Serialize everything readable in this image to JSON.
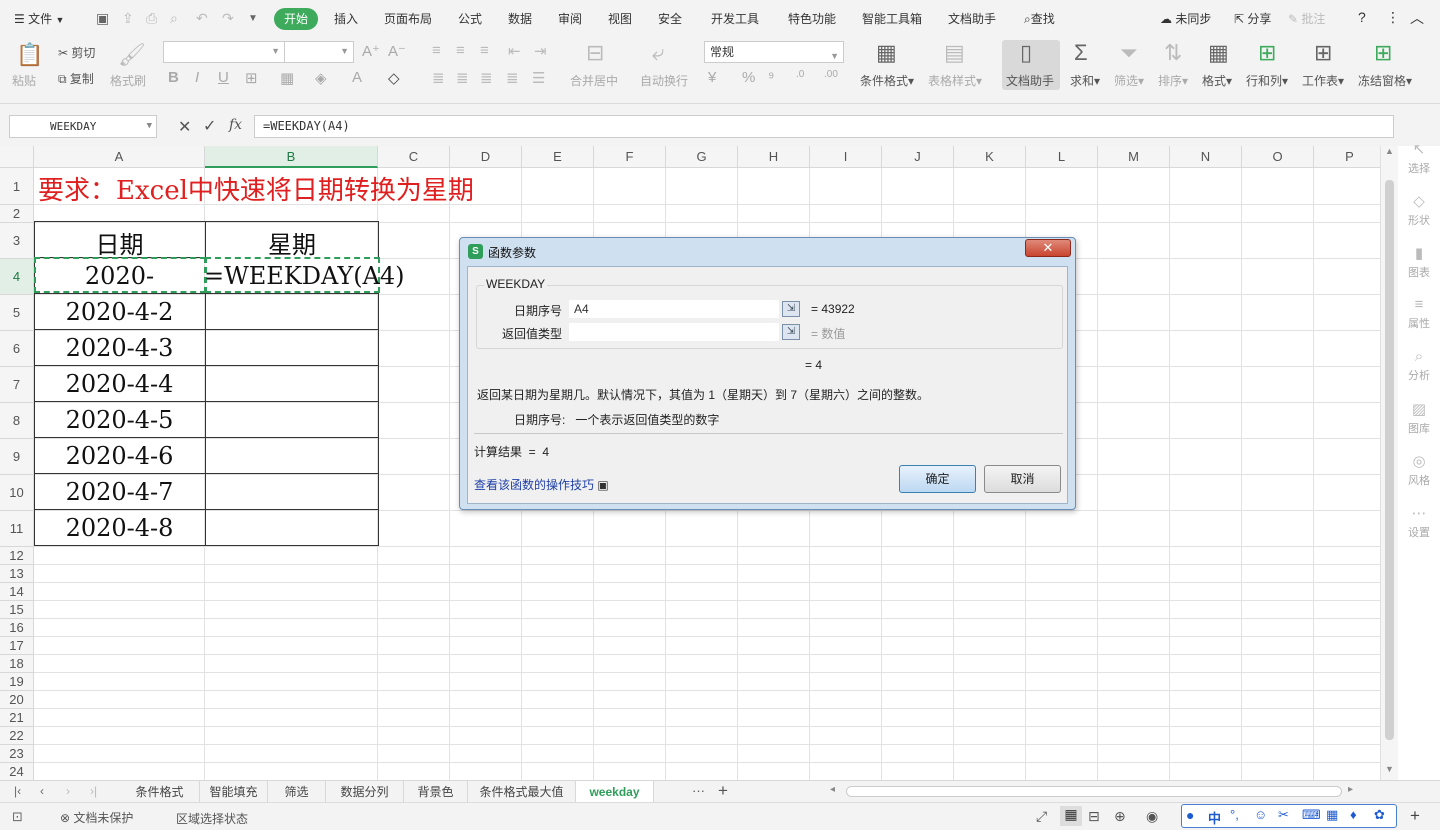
{
  "menu": {
    "file": "文件",
    "start": "开始",
    "items": [
      "插入",
      "页面布局",
      "公式",
      "数据",
      "审阅",
      "视图",
      "安全",
      "开发工具",
      "特色功能",
      "智能工具箱",
      "文档助手"
    ],
    "search": "查找",
    "sync": "未同步",
    "share": "分享",
    "comment": "批注"
  },
  "ribbon": {
    "paste": "粘贴",
    "cut": "剪切",
    "copy": "复制",
    "format_painter": "格式刷",
    "merge_center": "合并居中",
    "wrap": "自动换行",
    "number_format": "常规",
    "cond_format": "条件格式",
    "table_style": "表格样式",
    "doc_helper": "文档助手",
    "sum": "求和",
    "filter": "筛选",
    "sort": "排序",
    "format": "格式",
    "row_col": "行和列",
    "worksheet": "工作表",
    "freeze": "冻结窗格"
  },
  "formula_bar": {
    "name_box": "WEEKDAY",
    "fx": "fx",
    "formula": "=WEEKDAY(A4)"
  },
  "grid": {
    "columns": [
      "A",
      "B",
      "C",
      "D",
      "E",
      "F",
      "G",
      "H",
      "I",
      "J",
      "K",
      "L",
      "M",
      "N",
      "O",
      "P"
    ],
    "rows": [
      "1",
      "2",
      "3",
      "4",
      "5",
      "6",
      "7",
      "8",
      "9",
      "10",
      "11",
      "12",
      "13",
      "14",
      "15",
      "16",
      "17",
      "18",
      "19",
      "20",
      "21",
      "22",
      "23",
      "24"
    ],
    "title": "要求：Excel中快速将日期转换为星期",
    "header_date": "日期",
    "header_weekday": "星期",
    "dates": [
      "2020-",
      "2020-4-2",
      "2020-4-3",
      "2020-4-4",
      "2020-4-5",
      "2020-4-6",
      "2020-4-7",
      "2020-4-8"
    ],
    "b4_formula": "=WEEKDAY(A4)"
  },
  "side_panel": [
    "选择",
    "形状",
    "图表",
    "属性",
    "分析",
    "图库",
    "风格",
    "设置"
  ],
  "sheet_tabs": [
    "条件格式",
    "智能填充",
    "筛选",
    "数据分列",
    "背景色",
    "条件格式最大值",
    "weekday"
  ],
  "sheet_more": "···",
  "sheet_add": "+",
  "status": {
    "protect": "文档未保护",
    "region": "区域选择状态"
  },
  "dialog": {
    "title": "函数参数",
    "func_name": "WEEKDAY",
    "arg1_label": "日期序号",
    "arg1_value": "A4",
    "arg1_result": "=  43922",
    "arg2_label": "返回值类型",
    "arg2_result": "=  数值",
    "func_result": "=  4",
    "description": "返回某日期为星期几。默认情况下，其值为 1（星期天）到 7（星期六）之间的整数。",
    "arg_help": "日期序号:   一个表示返回值类型的数字",
    "calc_result": "计算结果  =  4",
    "help_link": "查看该函数的操作技巧",
    "ok": "确定",
    "cancel": "取消"
  },
  "colors": {
    "accent": "#3daa5c",
    "title_red": "#e02020",
    "selection_green": "#2f9e5a"
  }
}
